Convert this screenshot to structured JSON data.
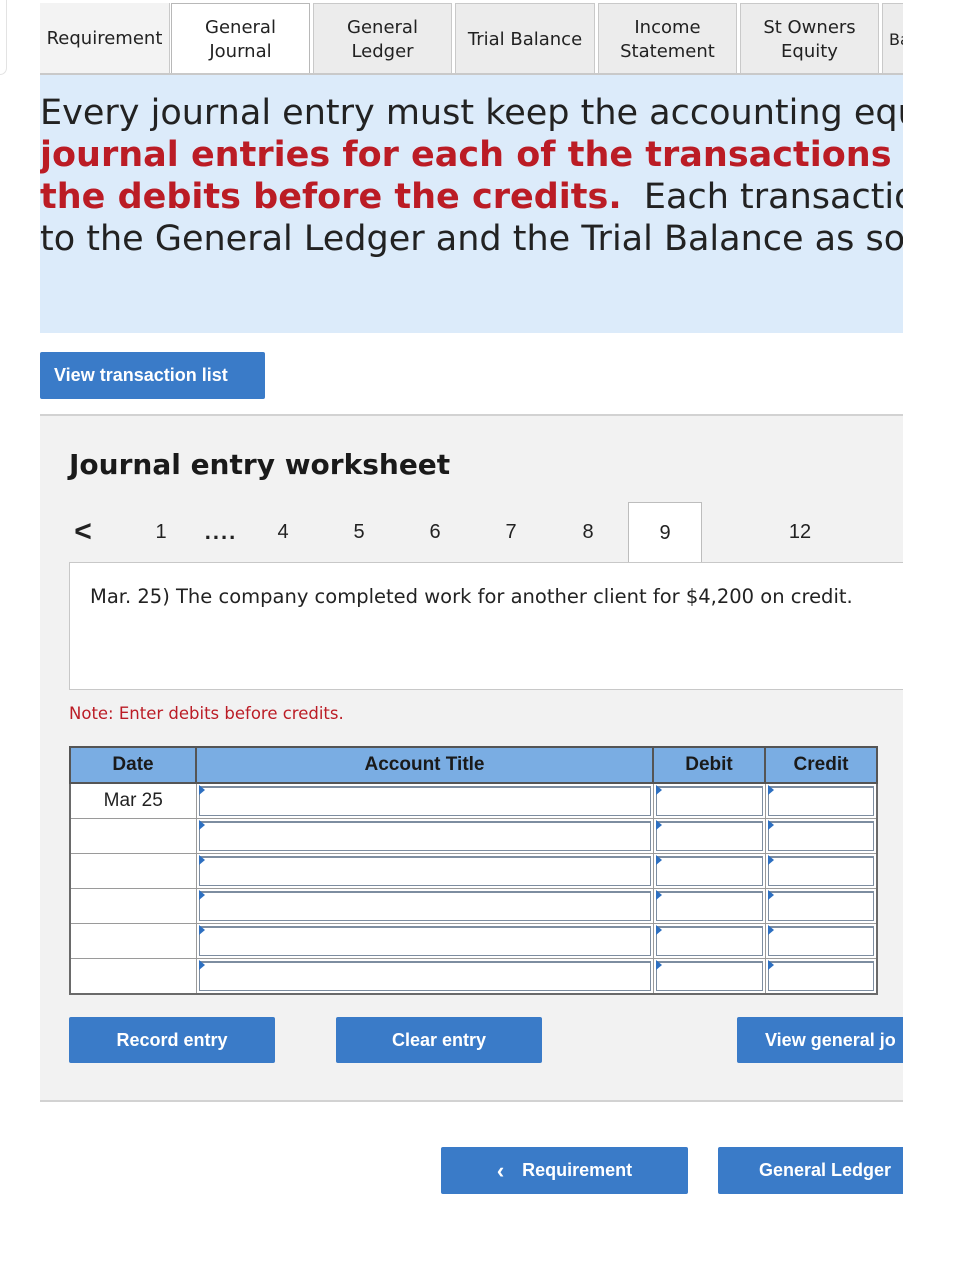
{
  "tabs": [
    {
      "label": "Requirement"
    },
    {
      "label": "General Journal",
      "line1": "General",
      "line2": "Journal"
    },
    {
      "label": "General Ledger",
      "line1": "General",
      "line2": "Ledger"
    },
    {
      "label": "Trial Balance"
    },
    {
      "label": "Income Statement",
      "line1": "Income",
      "line2": "Statement"
    },
    {
      "label": "St Owners Equity",
      "line1": "St Owners",
      "line2": "Equity"
    },
    {
      "label": "Ba"
    }
  ],
  "active_tab": "General Journal",
  "instructions": {
    "line1": "Every journal entry must keep the accounting equat",
    "line2_bold": "journal entries for each of the transactions of I",
    "line3_bold": "the debits before the credits.",
    "line3_rest": "Each transaction w",
    "line4": "to the General Ledger and the Trial Balance as soon"
  },
  "buttons": {
    "view_transaction_list": "View transaction list",
    "record_entry": "Record entry",
    "clear_entry": "Clear entry",
    "view_general_journal": "View general jo",
    "nav_prev": "Requirement",
    "nav_next": "General Ledger"
  },
  "worksheet": {
    "title": "Journal entry worksheet",
    "pager": {
      "prev_symbol": "<",
      "pages": [
        "1",
        "....",
        "4",
        "5",
        "6",
        "7",
        "8",
        "9",
        "12"
      ],
      "active_page": "9"
    },
    "transaction": "Mar. 25) The company completed work for another client for $4,200 on credit.",
    "note": "Note: Enter debits before credits.",
    "table": {
      "headers": {
        "date": "Date",
        "account": "Account Title",
        "debit": "Debit",
        "credit": "Credit"
      },
      "rows": [
        {
          "date": "Mar 25",
          "account": "",
          "debit": "",
          "credit": ""
        },
        {
          "date": "",
          "account": "",
          "debit": "",
          "credit": ""
        },
        {
          "date": "",
          "account": "",
          "debit": "",
          "credit": ""
        },
        {
          "date": "",
          "account": "",
          "debit": "",
          "credit": ""
        },
        {
          "date": "",
          "account": "",
          "debit": "",
          "credit": ""
        },
        {
          "date": "",
          "account": "",
          "debit": "",
          "credit": ""
        }
      ]
    }
  },
  "colors": {
    "accent_button": "#3a7bc8",
    "table_header": "#7aade3",
    "instruction_bg": "#dcebfa",
    "instruction_red": "#bb1c25"
  }
}
